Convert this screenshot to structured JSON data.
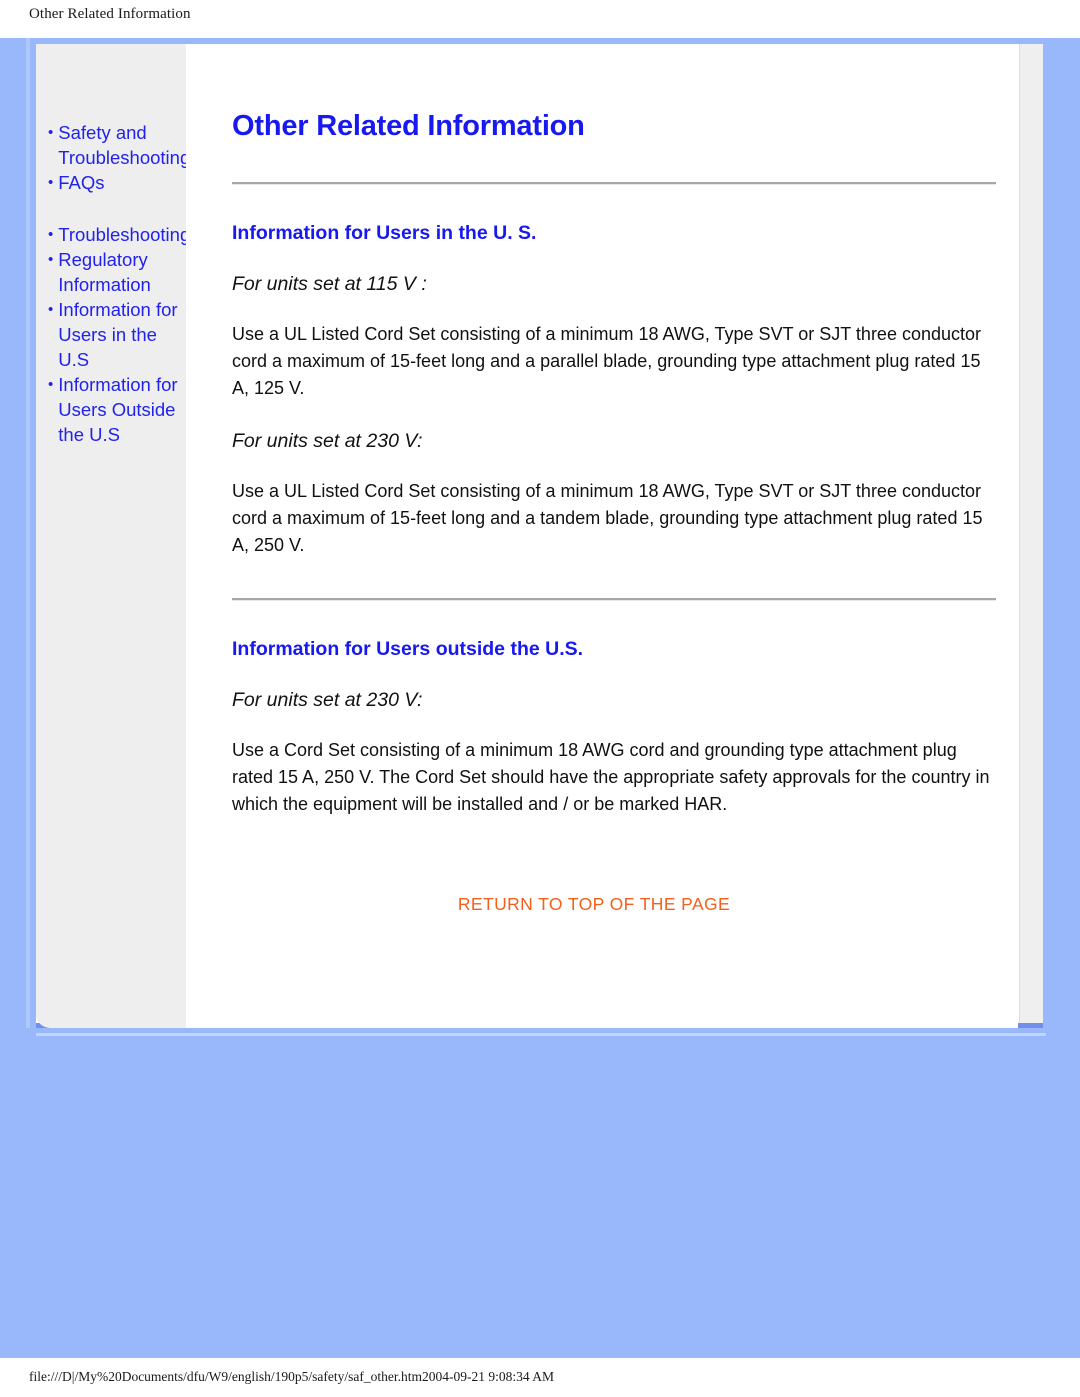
{
  "browser": {
    "header_title": "Other Related Information",
    "footer_path": "file:///D|/My%20Documents/dfu/W9/english/190p5/safety/saf_other.htm2004-09-21 9:08:34 AM"
  },
  "colors": {
    "page_background": "#98b8fb",
    "sidebar_background": "#eeeeee",
    "link_blue": "#2222ee",
    "heading_blue": "#1818f0",
    "return_link_orange": "#f4601c",
    "rule_gray": "#a7a7a7",
    "panel_border_blue": "#6f8fe8"
  },
  "sidebar": {
    "bullet": "•",
    "groups": [
      {
        "items": [
          {
            "label": "Safety and Troubleshooting"
          },
          {
            "label": "FAQs"
          }
        ]
      },
      {
        "items": [
          {
            "label": "Troubleshooting"
          },
          {
            "label": "Regulatory Information"
          },
          {
            "label": "Information for Users in the U.S"
          },
          {
            "label": "Information for Users Outside the U.S"
          }
        ]
      }
    ]
  },
  "main": {
    "page_title": "Other Related Information",
    "sections": [
      {
        "heading": "Information for Users in the U. S.",
        "blocks": [
          {
            "type": "unit",
            "text": "For units set at 115 V :"
          },
          {
            "type": "body",
            "text": "Use a UL Listed Cord Set consisting of a minimum 18 AWG, Type SVT or SJT three conductor cord a maximum of 15-feet long and a parallel blade, grounding type attachment plug rated 15 A, 125 V."
          },
          {
            "type": "unit",
            "text": "For units set at 230 V:"
          },
          {
            "type": "body",
            "text": "Use a UL Listed Cord Set consisting of a minimum 18 AWG, Type SVT or SJT three conductor cord a maximum of 15-feet long and a tandem blade, grounding type attachment plug rated 15 A, 250 V."
          }
        ]
      },
      {
        "heading": "Information for Users outside the U.S.",
        "blocks": [
          {
            "type": "unit",
            "text": "For units set at 230 V:"
          },
          {
            "type": "body",
            "text": "Use a Cord Set consisting of a minimum 18 AWG cord and grounding type attachment plug rated 15 A, 250 V. The Cord Set should have the appropriate safety approvals for the country in which the equipment will be installed and / or be marked HAR."
          }
        ]
      }
    ],
    "return_link": "RETURN TO TOP OF THE PAGE"
  }
}
